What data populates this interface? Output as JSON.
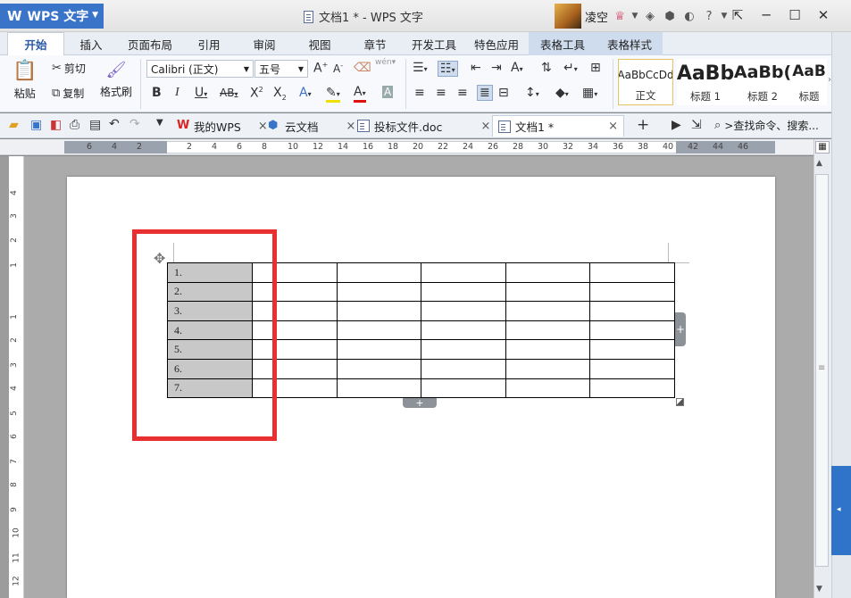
{
  "app": {
    "name": "WPS 文字",
    "logo": "W"
  },
  "window": {
    "title": "文档1 * - WPS 文字"
  },
  "user": {
    "name": "凌空",
    "icons": [
      "cloud-sync-icon",
      "skin-icon",
      "theme-icon",
      "help-icon"
    ]
  },
  "window_controls": [
    "restore-to-toolbar",
    "minimize",
    "maximize",
    "close"
  ],
  "ribbon_tabs": [
    "开始",
    "插入",
    "页面布局",
    "引用",
    "审阅",
    "视图",
    "章节",
    "开发工具",
    "特色应用",
    "表格工具",
    "表格样式"
  ],
  "active_tab": "开始",
  "clipboard": {
    "paste": "粘贴",
    "cut": "剪切",
    "copy": "复制",
    "format_painter": "格式刷"
  },
  "font": {
    "name": "Calibri (正文)",
    "size": "五号",
    "wen": "wén"
  },
  "styles": [
    {
      "sample": "AaBbCcDd",
      "name": "正文"
    },
    {
      "sample": "AaBb",
      "name": "标题 1"
    },
    {
      "sample": "AaBb(",
      "name": "标题 2"
    },
    {
      "sample": "AaB",
      "name": "标题"
    }
  ],
  "doc_tabs": [
    {
      "label": "我的WPS",
      "active": false
    },
    {
      "label": "云文档",
      "active": false
    },
    {
      "label": "投标文件.doc",
      "active": false
    },
    {
      "label": "文档1 *",
      "active": true
    }
  ],
  "command_search": {
    "placeholder": ">查找命令、搜索..."
  },
  "ruler": {
    "h_ticks": [
      "6",
      "4",
      "2",
      "2",
      "4",
      "6",
      "8",
      "10",
      "12",
      "14",
      "16",
      "18",
      "20",
      "22",
      "24",
      "26",
      "28",
      "30",
      "32",
      "34",
      "36",
      "38",
      "40",
      "42",
      "44",
      "46"
    ],
    "v_ticks": [
      "4",
      "3",
      "2",
      "1",
      "1",
      "2",
      "3",
      "4",
      "5",
      "6",
      "7",
      "8",
      "9",
      "10",
      "11",
      "12",
      "13",
      "14",
      "15",
      "16",
      "17"
    ]
  },
  "table": {
    "rows": [
      [
        "1.",
        "",
        "",
        "",
        "",
        ""
      ],
      [
        "2.",
        "",
        "",
        "",
        "",
        ""
      ],
      [
        "3.",
        "",
        "",
        "",
        "",
        ""
      ],
      [
        "4.",
        "",
        "",
        "",
        "",
        ""
      ],
      [
        "5.",
        "",
        "",
        "",
        "",
        ""
      ],
      [
        "6.",
        "",
        "",
        "",
        "",
        ""
      ],
      [
        "7.",
        "",
        "",
        "",
        "",
        ""
      ]
    ]
  },
  "colors": {
    "accent": "#3a74c9",
    "highlight_box": "#e83030",
    "selected_cell": "#c8c8c8"
  }
}
